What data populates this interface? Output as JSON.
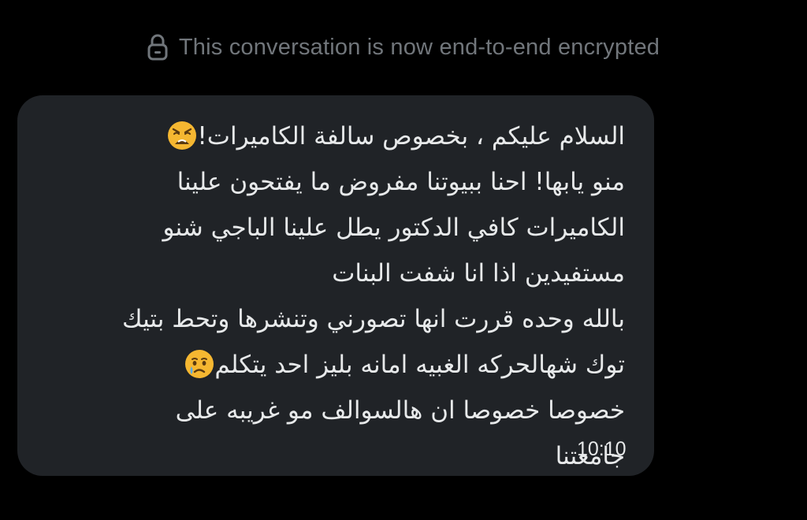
{
  "header": {
    "encryption_notice": "This conversation is now end-to-end encrypted",
    "icon": "lock-icon"
  },
  "message": {
    "direction": "incoming",
    "lines": [
      "السلام عليكم ، بخصوص سالفة الكاميرات!",
      "منو يابها! احنا ببيوتنا مفروض ما يفتحون علينا",
      "الكاميرات كافي الدكتور يطل علينا الباجي شنو",
      "مستفيدين اذا انا شفت البنات",
      "بالله وحده قررت انها تصورني وتنشرها وتحط بتيك",
      "توك شهالحركه الغبيه امانه بليز احد يتكلم",
      "خصوصا خصوصا ان هالسوالف مو غريبه على",
      "جامعتنا"
    ],
    "emojis": [
      "weary-face-emoji",
      "crying-face-emoji"
    ],
    "time": "10:10"
  },
  "colors": {
    "background": "#000000",
    "bubble": "#202327",
    "text": "#e7e9ea",
    "muted": "#71767b"
  }
}
